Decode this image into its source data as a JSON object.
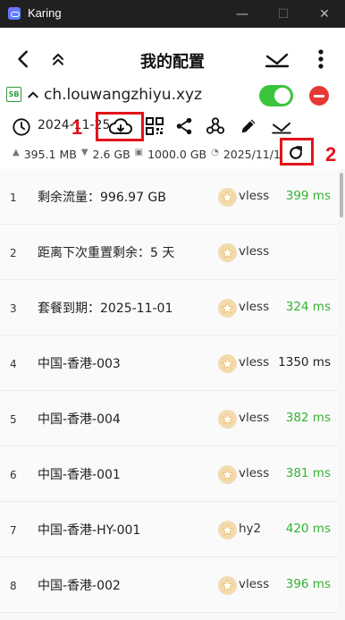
{
  "window": {
    "title": "Karing",
    "minimize": "—",
    "maximize": "☐",
    "close": "✕"
  },
  "header": {
    "title": "我的配置"
  },
  "profile": {
    "badge": "SB",
    "name": "ch.louwangzhiyu.xyz",
    "enabled": true,
    "date": "2024-11-25",
    "upload": "395.1 MB",
    "download": "2.6 GB",
    "total": "1000.0 GB",
    "expire": "2025/11/1"
  },
  "annotations": {
    "marker1": "1",
    "marker2": "2"
  },
  "nodes": [
    {
      "index": "1",
      "name": "剩余流量：996.97 GB",
      "protocol": "vless",
      "latency": "399 ms",
      "status": "good"
    },
    {
      "index": "2",
      "name": "距离下次重置剩余：5 天",
      "protocol": "vless",
      "latency": "",
      "status": "none"
    },
    {
      "index": "3",
      "name": "套餐到期：2025-11-01",
      "protocol": "vless",
      "latency": "324 ms",
      "status": "good"
    },
    {
      "index": "4",
      "name": "中国-香港-003",
      "protocol": "vless",
      "latency": "1350 ms",
      "status": "slow"
    },
    {
      "index": "5",
      "name": "中国-香港-004",
      "protocol": "vless",
      "latency": "382 ms",
      "status": "good"
    },
    {
      "index": "6",
      "name": "中国-香港-001",
      "protocol": "vless",
      "latency": "381 ms",
      "status": "good"
    },
    {
      "index": "7",
      "name": "中国-香港-HY-001",
      "protocol": "hy2",
      "latency": "420 ms",
      "status": "good"
    },
    {
      "index": "8",
      "name": "中国-香港-002",
      "protocol": "vless",
      "latency": "396 ms",
      "status": "good"
    }
  ],
  "colors": {
    "accent_red": "#e3131b",
    "toggle_on": "#3cc43c",
    "latency_good": "#33b233"
  }
}
